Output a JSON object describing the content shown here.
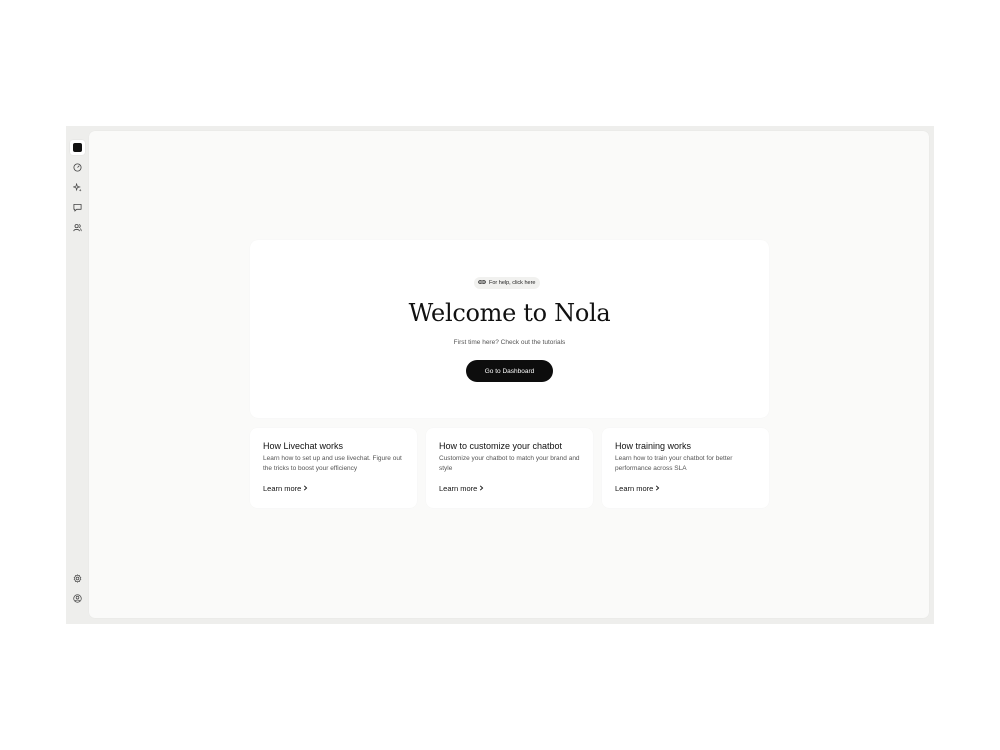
{
  "sidebar": {
    "top_items": [
      {
        "icon": "logo-square-icon"
      },
      {
        "icon": "gauge-icon"
      },
      {
        "icon": "sparkles-icon"
      },
      {
        "icon": "chat-bubble-icon"
      },
      {
        "icon": "users-icon"
      }
    ],
    "bottom_items": [
      {
        "icon": "gear-icon"
      },
      {
        "icon": "user-circle-icon"
      }
    ]
  },
  "hero": {
    "help_link": "For help, click here",
    "title": "Welcome to Nola",
    "subtitle": "First time here? Check out the tutorials",
    "button_label": "Go to Dashboard"
  },
  "cards": [
    {
      "title": "How Livechat works",
      "description": "Learn how to set up and use livechat. Figure out the tricks to boost your efficiency",
      "link": "Learn more"
    },
    {
      "title": "How to customize your chatbot",
      "description": "Customize your chatbot to match your brand and style",
      "link": "Learn more"
    },
    {
      "title": "How training works",
      "description": "Learn how to train your chatbot for better performance across SLA",
      "link": "Learn more"
    }
  ],
  "colors": {
    "frame": "#eeeeec",
    "panel": "#fafaf9",
    "card": "#ffffff",
    "primary_button": "#0d0d0d"
  }
}
